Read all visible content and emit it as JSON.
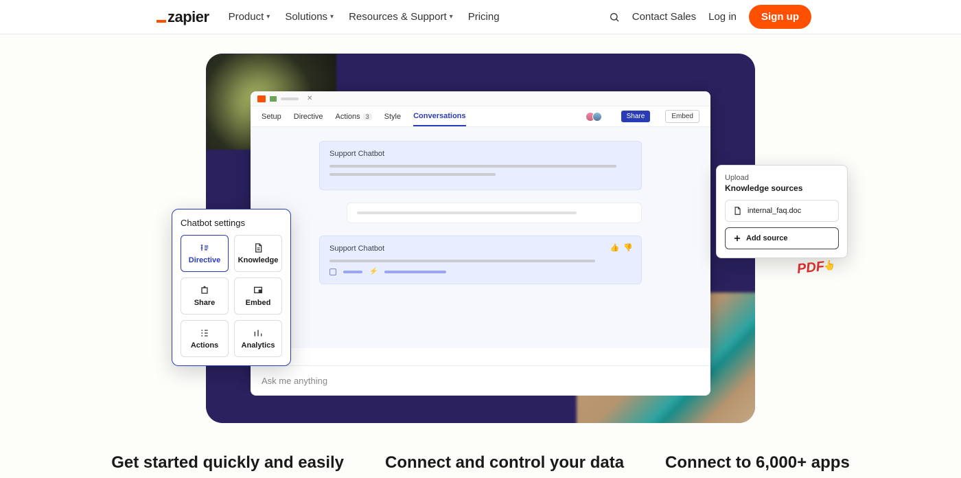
{
  "nav": {
    "brand": "zapier",
    "items": [
      "Product",
      "Solutions",
      "Resources & Support",
      "Pricing"
    ],
    "contact": "Contact Sales",
    "login": "Log in",
    "signup": "Sign up"
  },
  "app": {
    "tabs": {
      "setup": "Setup",
      "directive": "Directive",
      "actions": "Actions",
      "actions_count": "3",
      "style": "Style",
      "conversations": "Conversations"
    },
    "share": "Share",
    "embed": "Embed",
    "bubble_title": "Support Chatbot",
    "ask_placeholder": "Ask me anything"
  },
  "settings": {
    "title": "Chatbot settings",
    "tiles": {
      "directive": "Directive",
      "knowledge": "Knowledge",
      "share": "Share",
      "embed": "Embed",
      "actions": "Actions",
      "analytics": "Analytics"
    }
  },
  "upload": {
    "label": "Upload",
    "heading": "Knowledge sources",
    "file": "internal_faq.doc",
    "add": "Add source",
    "pdf": "PDF"
  },
  "columns": {
    "c1": "Get started quickly and easily",
    "c2": "Connect and control your data",
    "c3": "Connect to 6,000+ apps"
  }
}
